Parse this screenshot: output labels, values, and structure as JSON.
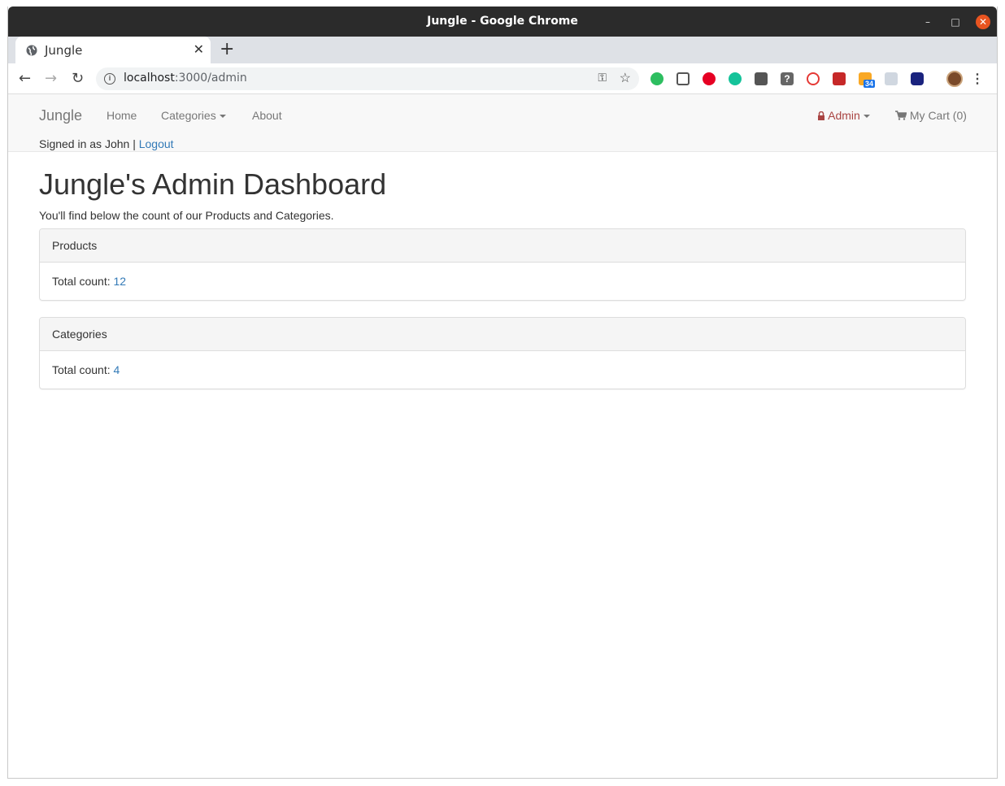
{
  "window": {
    "title": "Jungle - Google Chrome"
  },
  "tab": {
    "title": "Jungle"
  },
  "address": {
    "host": "localhost",
    "path": ":3000/admin"
  },
  "extensions": {
    "badge_count": "34",
    "colors": [
      "#2dbe60",
      "#555555",
      "#e60023",
      "#15c39a",
      "#555555",
      "#666666",
      "#e53935",
      "#c62828",
      "#f9a825",
      "#d0d7e0",
      "#1a237e"
    ]
  },
  "navbar": {
    "brand": "Jungle",
    "home": "Home",
    "categories": "Categories",
    "about": "About",
    "admin": "Admin",
    "cart": "My Cart (0)"
  },
  "session": {
    "signed_in_text": "Signed in as John |",
    "logout": "Logout"
  },
  "dashboard": {
    "title": "Jungle's Admin Dashboard",
    "subtitle": "You'll find below the count of our Products and Categories.",
    "panels": [
      {
        "heading": "Products",
        "label": "Total count:",
        "count": "12"
      },
      {
        "heading": "Categories",
        "label": "Total count:",
        "count": "4"
      }
    ]
  }
}
